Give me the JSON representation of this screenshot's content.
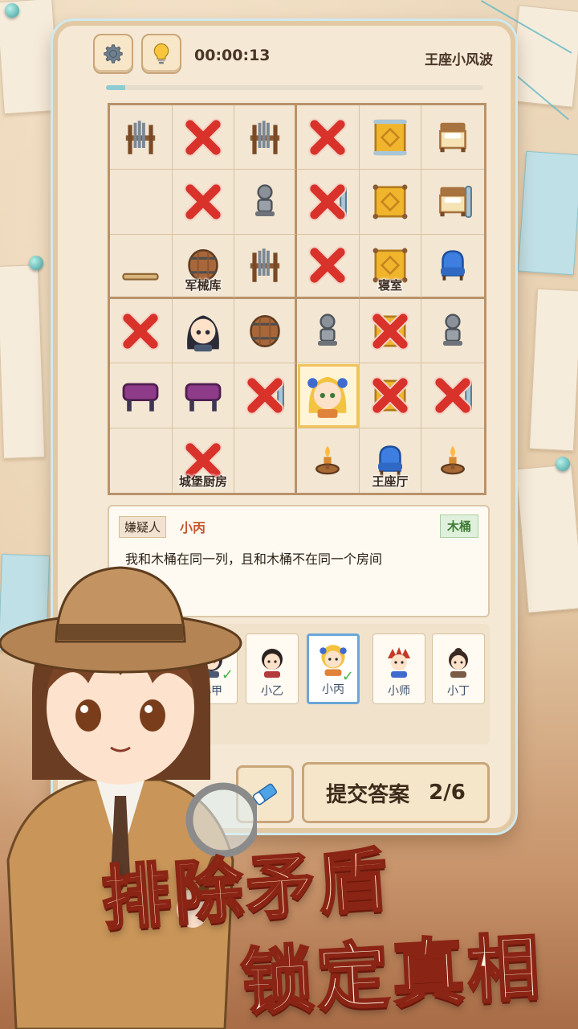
{
  "header": {
    "timer": "00:00:13",
    "level_title": "王座小风波",
    "progress": 0.05
  },
  "rooms": {
    "armory": "军械库",
    "bedroom": "寝室",
    "kitchen": "城堡厨房",
    "throne_hall": "王座厅"
  },
  "clue": {
    "tag": "嫌疑人",
    "suspect": "小丙",
    "item": "木桶",
    "text": "我和木桶在同一列，且和木桶不在同一个房间"
  },
  "characters": [
    {
      "name": "小甲",
      "checked": true
    },
    {
      "name": "小乙",
      "checked": false
    },
    {
      "name": "小丙",
      "checked": true,
      "active": true
    },
    {
      "name": "小师",
      "checked": false
    },
    {
      "name": "小丁",
      "checked": false
    }
  ],
  "submit": {
    "label": "提交答案",
    "count": "2/6"
  },
  "slogan": {
    "line1": "排除矛盾",
    "line2": "锁定真相"
  },
  "colors": {
    "cross": "#d8322a",
    "accent_blue": "#8fcbd3",
    "gold": "#e7a92e"
  }
}
